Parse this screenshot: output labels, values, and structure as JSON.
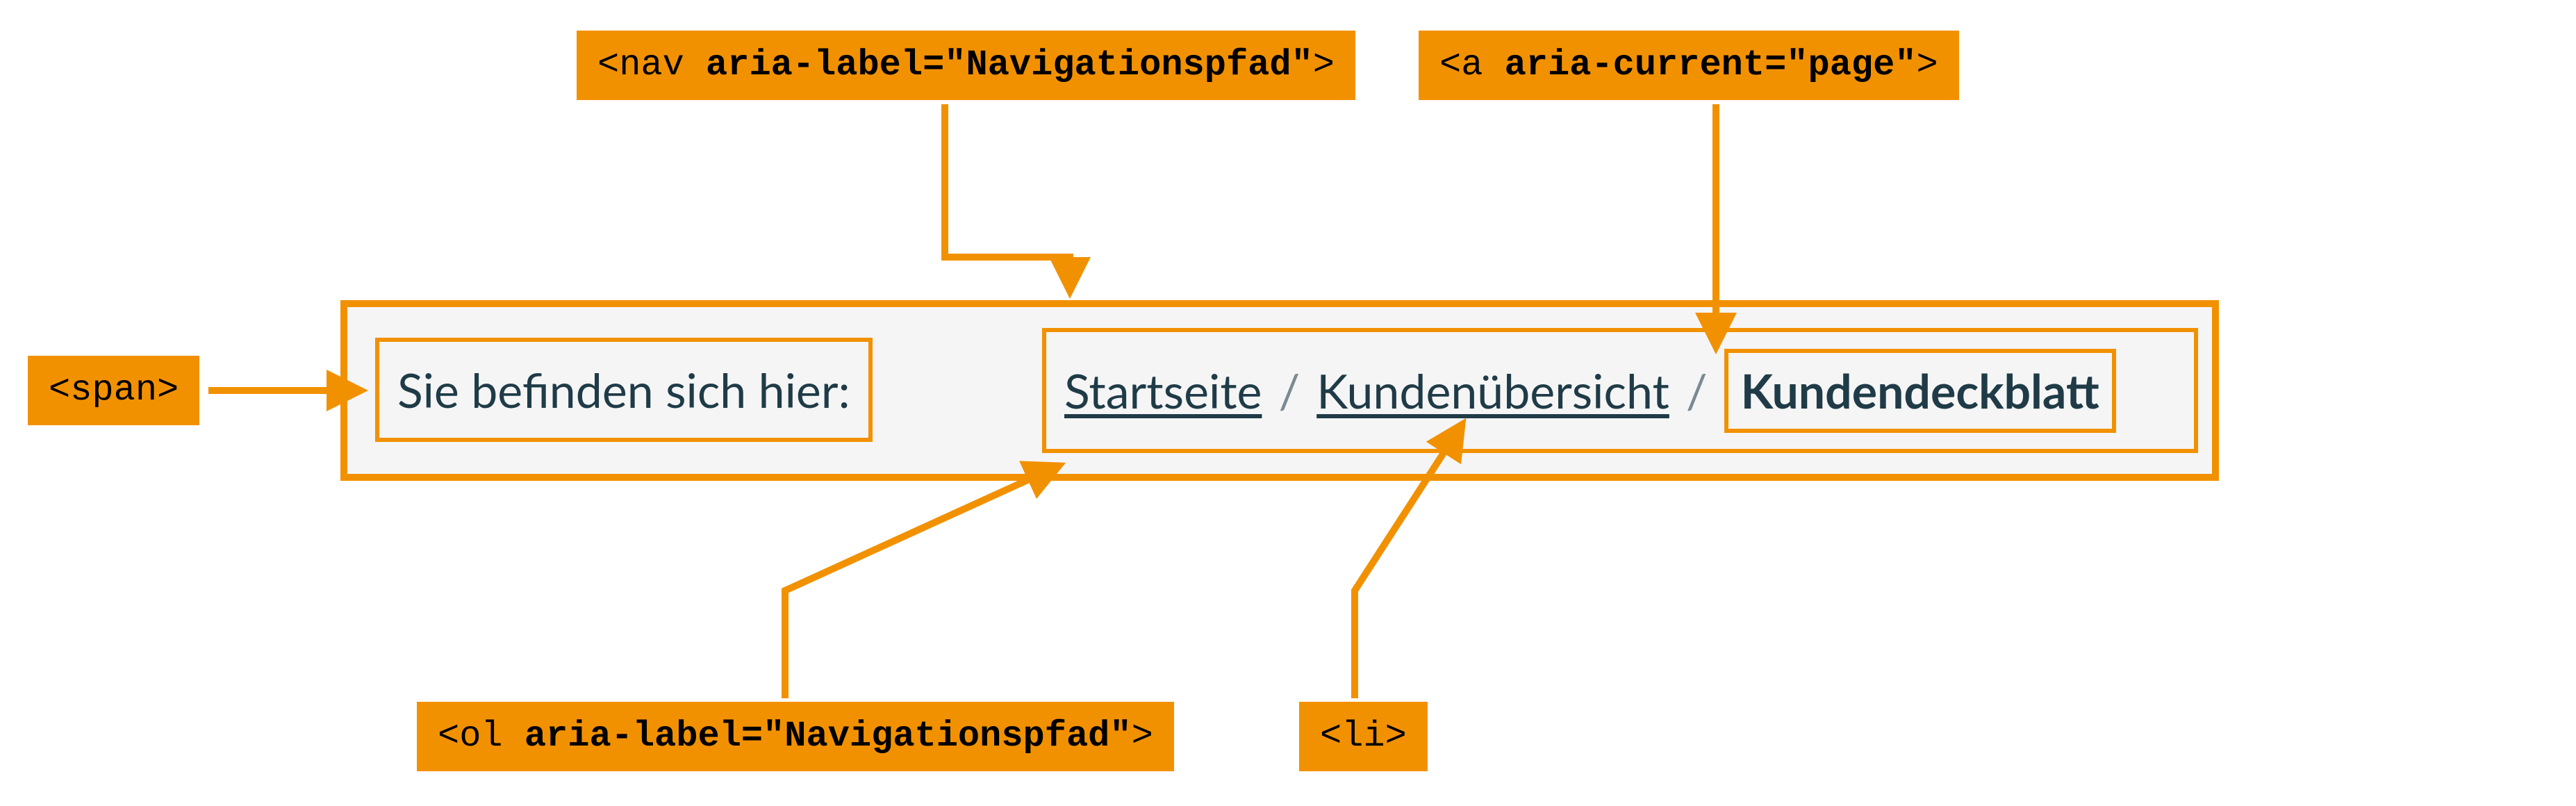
{
  "callouts": {
    "nav": "<nav aria-label=\"Navigationspfad\">",
    "a": "<a aria-current=\"page\">",
    "span": "<span>",
    "ol": "<ol aria-label=\"Navigationspfad\">",
    "li": "<li>"
  },
  "callouts_parts": {
    "nav_tag": "<nav ",
    "nav_attr": "aria-label=\"Navigationspfad\"",
    "nav_end": ">",
    "a_tag": "<a ",
    "a_attr": "aria-current=\"page\"",
    "a_end": ">",
    "ol_tag": "<ol ",
    "ol_attr": "aria-label=\"Navigationspfad\"",
    "ol_end": ">"
  },
  "breadcrumb": {
    "prefix": "Sie befinden sich hier:",
    "items": [
      "Startseite",
      "Kundenübersicht",
      "Kundendeckblatt"
    ],
    "separator": "/"
  },
  "colors": {
    "orange": "#f29100",
    "text_dark": "#1f3b47",
    "sep_grey": "#7b8a92",
    "bg_grey": "#f5f5f5"
  }
}
